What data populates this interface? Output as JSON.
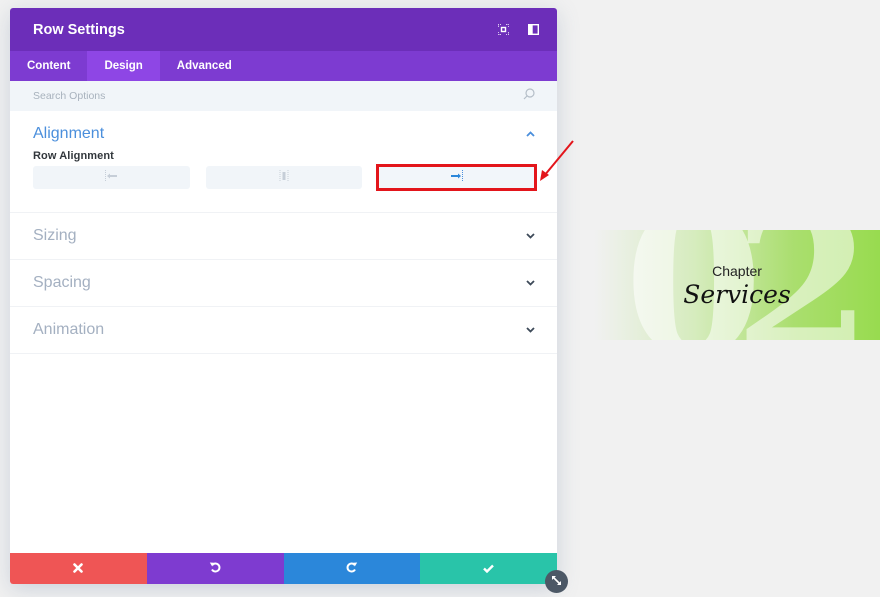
{
  "panel": {
    "title": "Row Settings",
    "header_icons": [
      "fullscreen-icon",
      "sidebar-layout-icon"
    ],
    "tabs": [
      {
        "label": "Content",
        "active": false
      },
      {
        "label": "Design",
        "active": true
      },
      {
        "label": "Advanced",
        "active": false
      }
    ],
    "search": {
      "placeholder": "Search Options",
      "value": ""
    },
    "sections": [
      {
        "title": "Alignment",
        "open": true
      },
      {
        "title": "Sizing",
        "open": false
      },
      {
        "title": "Spacing",
        "open": false
      },
      {
        "title": "Animation",
        "open": false
      }
    ],
    "alignment": {
      "field_label": "Row Alignment",
      "options": [
        "left",
        "center",
        "right"
      ],
      "selected": "right"
    },
    "footer": {
      "buttons": [
        "cancel",
        "undo",
        "redo",
        "save"
      ],
      "colors": {
        "cancel": "#ef5555",
        "undo": "#7e3bd0",
        "redo": "#2b87da",
        "save": "#29c4a9"
      }
    }
  },
  "preview": {
    "number": "02",
    "chapter": "Chapter",
    "title": "Services"
  },
  "colors": {
    "header": "#6c2eb9",
    "tabs": "#7d3bd1",
    "active_tab": "#8e46e5",
    "accent_blue": "#4b8fdc",
    "annotation_red": "#e3151b"
  }
}
